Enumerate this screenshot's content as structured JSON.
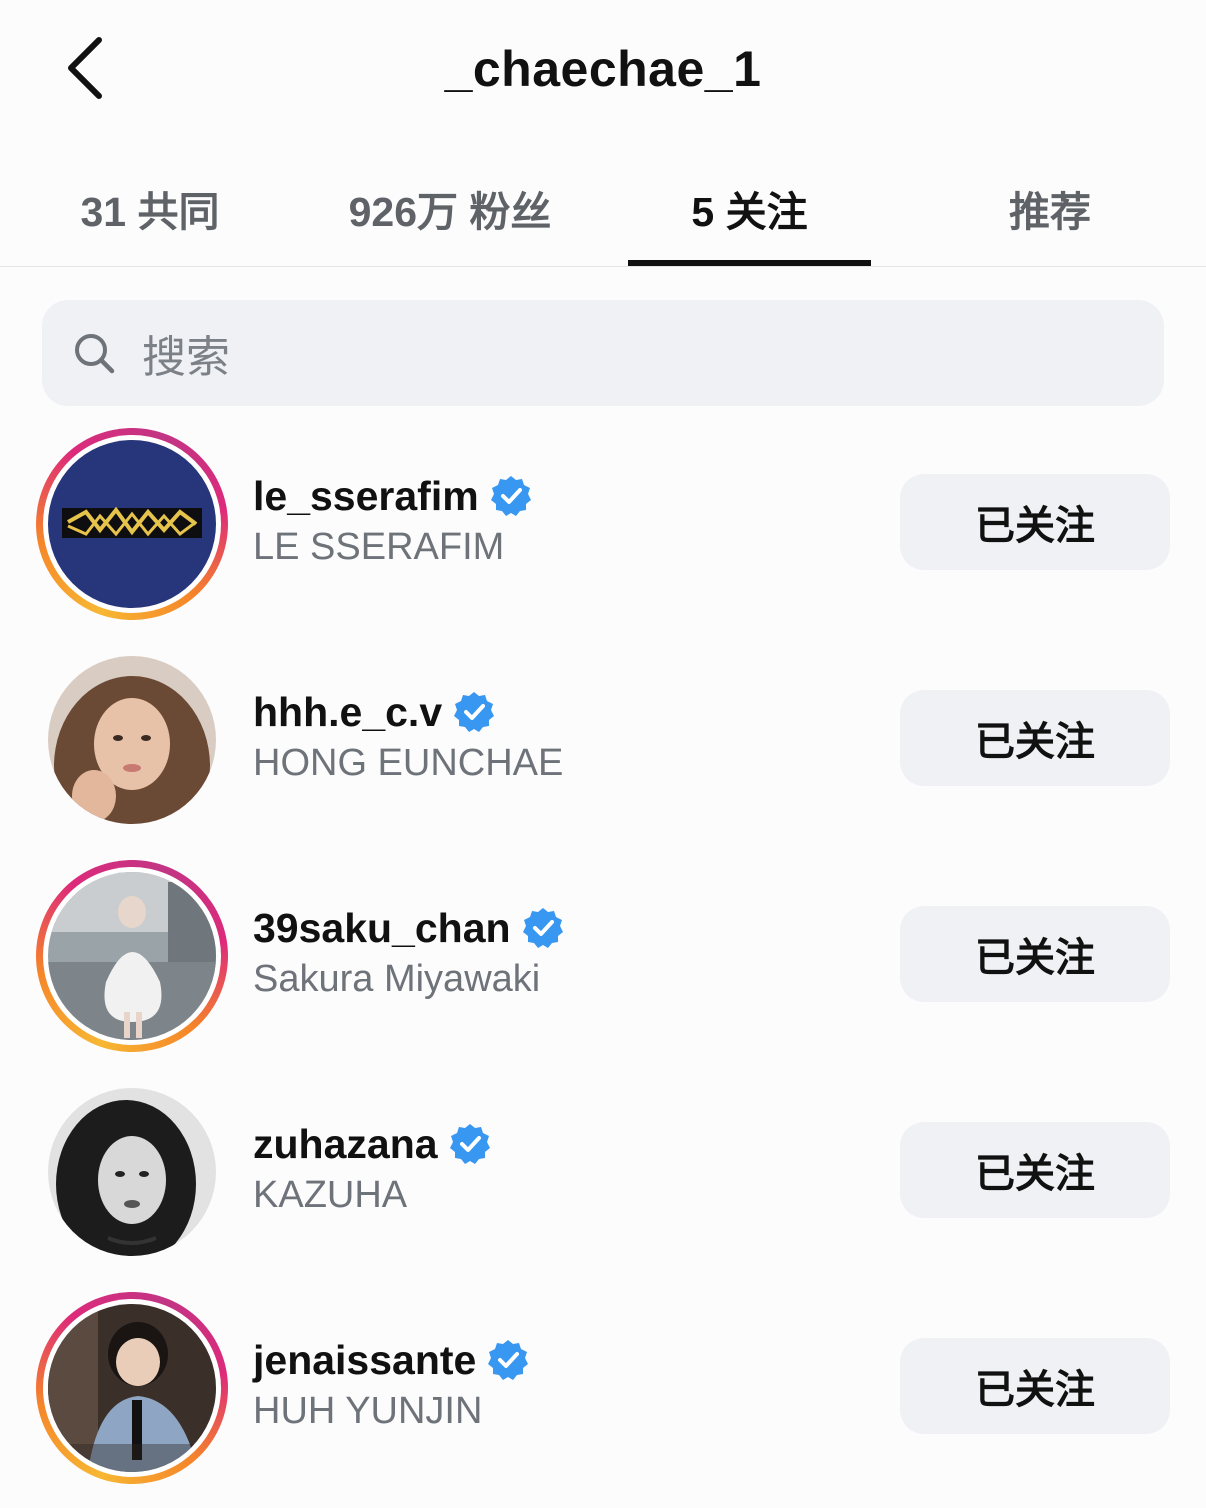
{
  "header": {
    "title": "_chaechae_1"
  },
  "tabs": [
    {
      "label": "31 共同"
    },
    {
      "label": "926万 粉丝"
    },
    {
      "label": "5 关注"
    },
    {
      "label": "推荐"
    }
  ],
  "active_tab": 2,
  "search": {
    "placeholder": "搜索"
  },
  "accent_colors": {
    "verified": "#3897f0",
    "ring_start": "#f7b733",
    "ring_end": "#dd2a7b"
  },
  "following": [
    {
      "username": "le_sserafim",
      "full_name": "LE SSERAFIM",
      "button": "已关注",
      "verified": true,
      "story_ring": true
    },
    {
      "username": "hhh.e_c.v",
      "full_name": "HONG EUNCHAE",
      "button": "已关注",
      "verified": true,
      "story_ring": false
    },
    {
      "username": "39saku_chan",
      "full_name": "Sakura Miyawaki",
      "button": "已关注",
      "verified": true,
      "story_ring": true
    },
    {
      "username": "zuhazana",
      "full_name": "KAZUHA",
      "button": "已关注",
      "verified": true,
      "story_ring": false
    },
    {
      "username": "jenaissante",
      "full_name": "HUH YUNJIN",
      "button": "已关注",
      "verified": true,
      "story_ring": true
    }
  ]
}
